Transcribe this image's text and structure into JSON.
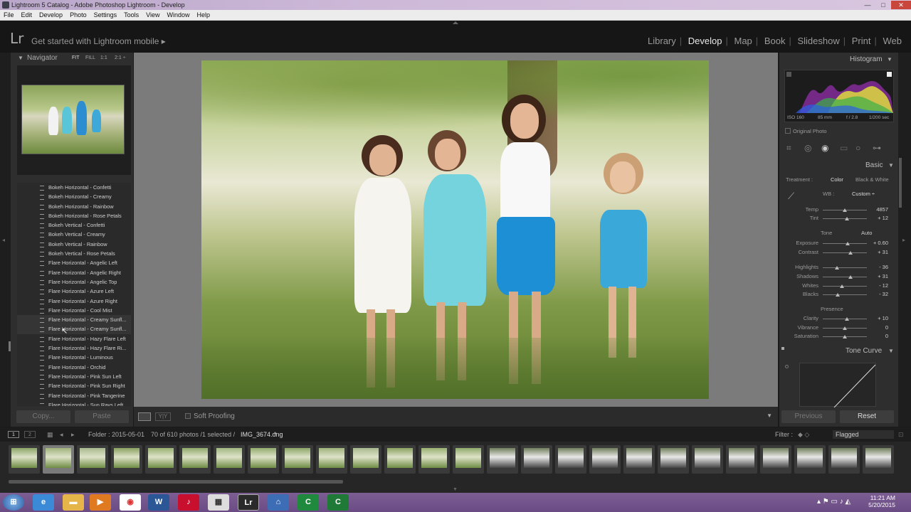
{
  "window": {
    "title": "Lightroom 5 Catalog - Adobe Photoshop Lightroom - Develop",
    "controls": [
      "—",
      "□",
      "✕"
    ]
  },
  "menu": [
    "File",
    "Edit",
    "Develop",
    "Photo",
    "Settings",
    "Tools",
    "View",
    "Window",
    "Help"
  ],
  "topbar": {
    "logo": "Lr",
    "mobile_prompt": "Get started with Lightroom mobile ▸",
    "modules": [
      "Library",
      "Develop",
      "Map",
      "Book",
      "Slideshow",
      "Print",
      "Web"
    ],
    "active_module": "Develop"
  },
  "navigator": {
    "title": "Navigator",
    "zoom_options": [
      "FIT",
      "FILL",
      "1:1",
      "2:1 ÷"
    ]
  },
  "presets": [
    "Bokeh Horizontal - Confetti",
    "Bokeh Horizontal - Creamy",
    "Bokeh Horizontal - Rainbow",
    "Bokeh Horizontal - Rose Petals",
    "Bokeh Vertical - Confetti",
    "Bokeh Vertical - Creamy",
    "Bokeh Vertical - Rainbow",
    "Bokeh Vertical - Rose Petals",
    "Flare Horizontal - Angelic Left",
    "Flare Horizontal - Angelic Right",
    "Flare Horizontal - Angelic Top",
    "Flare Horizontal - Azure Left",
    "Flare Horizontal - Azure Right",
    "Flare Horizontal - Cool Mist",
    "Flare Horizontal - Creamy Sunfl...",
    "Flare Horizontal - Creamy Sunfl...",
    "Flare Horizontal - Hazy Flare Left",
    "Flare Horizontal - Hazy Flare Ri...",
    "Flare Horizontal - Luminous",
    "Flare Horizontal - Orchid",
    "Flare Horizontal - Pink Sun Left",
    "Flare Horizontal - Pink Sun Right",
    "Flare Horizontal - Pink Tangerine",
    "Flare Horizontal - Sun Rays Left"
  ],
  "left_buttons": {
    "copy": "Copy...",
    "paste": "Paste"
  },
  "toolbar": {
    "soft_proofing": "Soft Proofing"
  },
  "histogram": {
    "title": "Histogram",
    "iso": "ISO 160",
    "focal": "85 mm",
    "aperture": "f / 2.8",
    "shutter": "1/200 sec",
    "original_photo": "Original Photo"
  },
  "basic": {
    "title": "Basic",
    "treatment_label": "Treatment :",
    "treatment_color": "Color",
    "treatment_bw": "Black & White",
    "wb_label": "WB :",
    "wb_value": "Custom ÷",
    "tone_label": "Tone",
    "auto_label": "Auto",
    "presence_label": "Presence",
    "sliders": [
      {
        "label": "Temp",
        "value": "4857",
        "pos": 0.5
      },
      {
        "label": "Tint",
        "value": "+ 12",
        "pos": 0.55
      },
      {
        "label": "Exposure",
        "value": "+ 0.60",
        "pos": 0.56
      },
      {
        "label": "Contrast",
        "value": "+ 31",
        "pos": 0.63
      },
      {
        "label": "Highlights",
        "value": "- 36",
        "pos": 0.33
      },
      {
        "label": "Shadows",
        "value": "+ 31",
        "pos": 0.63
      },
      {
        "label": "Whites",
        "value": "- 12",
        "pos": 0.44
      },
      {
        "label": "Blacks",
        "value": "- 32",
        "pos": 0.34
      },
      {
        "label": "Clarity",
        "value": "+ 10",
        "pos": 0.55
      },
      {
        "label": "Vibrance",
        "value": "0",
        "pos": 0.5
      },
      {
        "label": "Saturation",
        "value": "0",
        "pos": 0.5
      }
    ]
  },
  "tone_curve": {
    "title": "Tone Curve"
  },
  "right_buttons": {
    "previous": "Previous",
    "reset": "Reset"
  },
  "filmstrip_header": {
    "page1": "1",
    "page2": "2",
    "folder": "Folder : 2015-05-01",
    "count": "70 of 610 photos /1 selected /",
    "filename": "IMG_3674.dng",
    "filter_label": "Filter :",
    "filter_value": "Flagged"
  },
  "clock": {
    "time": "11:21 AM",
    "date": "5/20/2015"
  },
  "colors": {
    "panel": "#2e2e2e",
    "taskbar": "#6b4b84",
    "accent_active": "#e8e8e8"
  }
}
